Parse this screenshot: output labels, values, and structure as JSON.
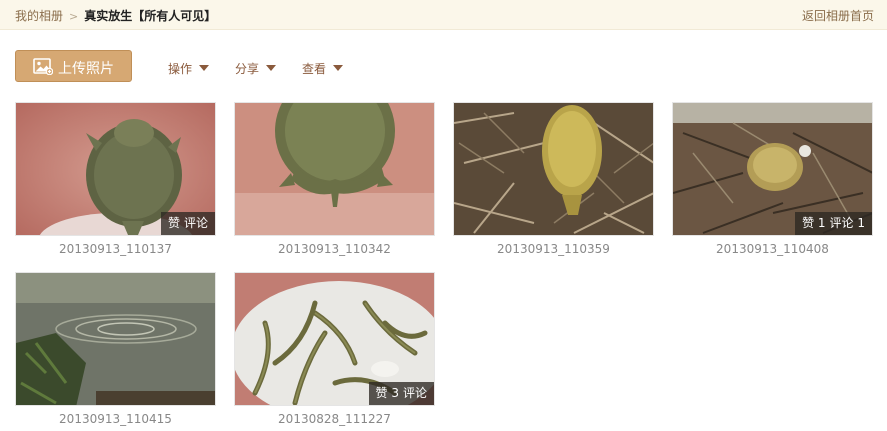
{
  "breadcrumb": {
    "root": "我的相册",
    "separator": ">",
    "current": "真实放生【所有人可见】"
  },
  "back_link": "返回相册首页",
  "toolbar": {
    "upload_label": "上传照片",
    "upload_icon": "image-add-icon",
    "menus": [
      "操作",
      "分享",
      "查看"
    ]
  },
  "photos": [
    {
      "caption": "20130913_110137",
      "likes": "赞",
      "comments": "评论"
    },
    {
      "caption": "20130913_110342"
    },
    {
      "caption": "20130913_110359"
    },
    {
      "caption": "20130913_110408",
      "likes": "赞 1",
      "comments": "评论 1"
    },
    {
      "caption": "20130913_110415"
    },
    {
      "caption": "20130828_111227",
      "likes": "赞 3",
      "comments": "评论"
    }
  ],
  "colors": {
    "topbar_bg": "#fbf7ea",
    "link": "#8a6d4b",
    "upload_button": "#d6a873",
    "menu_text": "#8a5a3c"
  }
}
